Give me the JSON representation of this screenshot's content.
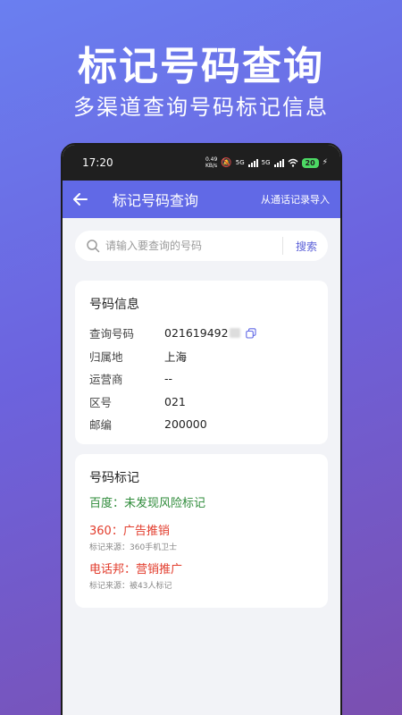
{
  "promo": {
    "title": "标记号码查询",
    "subtitle": "多渠道查询号码标记信息"
  },
  "status_bar": {
    "time": "17:20",
    "net_speed_value": "0.49",
    "net_speed_unit": "KB/s",
    "sim1": "5G",
    "sim2": "5G",
    "battery": "20"
  },
  "app_bar": {
    "title": "标记号码查询",
    "import_label": "从通话记录导入"
  },
  "search": {
    "placeholder": "请输入要查询的号码",
    "button_label": "搜索"
  },
  "number_info": {
    "title": "号码信息",
    "rows": [
      {
        "label": "查询号码",
        "value": "021619492"
      },
      {
        "label": "归属地",
        "value": "上海"
      },
      {
        "label": "运营商",
        "value": "--"
      },
      {
        "label": "区号",
        "value": "021"
      },
      {
        "label": "邮编",
        "value": "200000"
      }
    ]
  },
  "number_marks": {
    "title": "号码标记",
    "items": [
      {
        "text": "百度：未发现风险标记",
        "source": ""
      },
      {
        "text": "360：广告推销",
        "source": "标记来源：360手机卫士"
      },
      {
        "text": "电话邦：营销推广",
        "source": "标记来源：被43人标记"
      }
    ]
  },
  "colors": {
    "accent": "#6169e6",
    "safe": "#2e8b3a",
    "warning": "#e23c2c"
  }
}
